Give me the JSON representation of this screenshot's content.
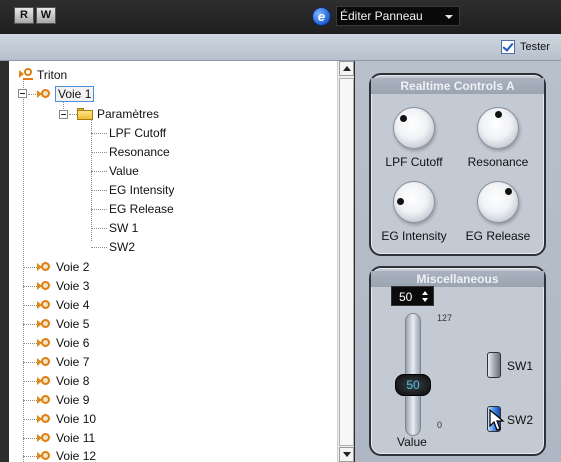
{
  "titlebar": {
    "r_label": "R",
    "w_label": "W",
    "panel_select_value": "Éditer Panneau"
  },
  "toolbar": {
    "tester_label": "Tester",
    "tester_checked": true
  },
  "tree": {
    "root": "Triton",
    "selected": "Voie 1",
    "folder": "Paramètres",
    "parameters": [
      "LPF Cutoff",
      "Resonance",
      "Value",
      "EG Intensity",
      "EG Release",
      "SW 1",
      "SW2"
    ],
    "channels": [
      "Voie 2",
      "Voie 3",
      "Voie 4",
      "Voie 5",
      "Voie 6",
      "Voie 7",
      "Voie 8",
      "Voie 9",
      "Voie 10",
      "Voie 11",
      "Voie 12"
    ]
  },
  "realtime": {
    "title": "Realtime Controls A",
    "knobs": [
      {
        "label": "LPF Cutoff"
      },
      {
        "label": "Resonance"
      },
      {
        "label": "EG Intensity"
      },
      {
        "label": "EG Release"
      }
    ]
  },
  "misc": {
    "title": "Miscellaneous",
    "value_box": "50",
    "fader_value": "50",
    "fader_max": "127",
    "fader_min": "0",
    "fader_label": "Value",
    "sw1_label": "SW1",
    "sw2_label": "SW2"
  },
  "colors": {
    "selection_border": "#4c8fdb",
    "switch_active": "#3e86e6",
    "fader_text": "#4fc3e8",
    "orange_icon": "#e07d0f"
  }
}
